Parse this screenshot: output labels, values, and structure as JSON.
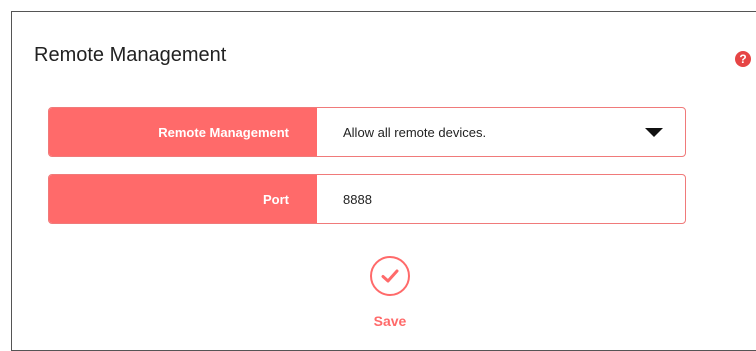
{
  "section": {
    "title": "Remote Management"
  },
  "help": {
    "icon": "help-icon",
    "glyph": "?"
  },
  "fields": {
    "remote_management": {
      "label": "Remote Management",
      "selected": "Allow all remote devices.",
      "control": "dropdown"
    },
    "port": {
      "label": "Port",
      "value": "8888"
    }
  },
  "actions": {
    "save_label": "Save",
    "save_icon": "check-icon"
  },
  "colors": {
    "accent": "#ff6a6a",
    "help_icon": "#e64545",
    "row_border": "#f07a7a"
  }
}
